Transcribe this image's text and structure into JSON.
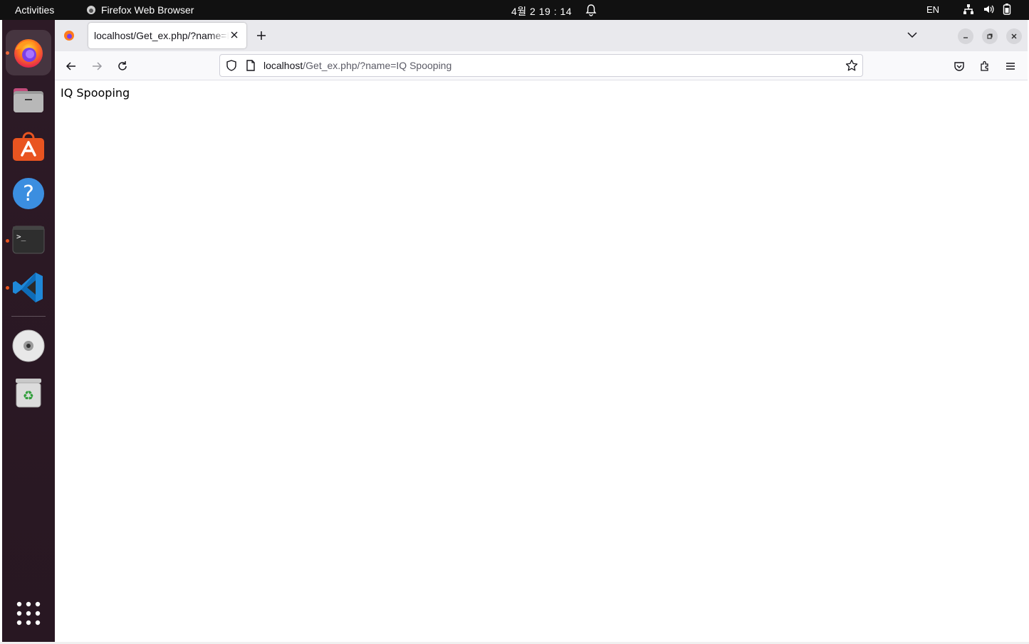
{
  "topbar": {
    "activities": "Activities",
    "app_name": "Firefox Web Browser",
    "clock": "4월 2  19 : 14",
    "language": "EN"
  },
  "dock": {
    "items": [
      "firefox",
      "files",
      "app-center",
      "help",
      "terminal",
      "vscode",
      "disc",
      "trash",
      "show-apps"
    ]
  },
  "browser": {
    "tab": {
      "title": "localhost/Get_ex.php/?name=IQ Spooping"
    },
    "url": {
      "host": "localhost",
      "rest": "/Get_ex.php/?name=IQ Spooping"
    },
    "page_text": "IQ Spooping"
  },
  "colors": {
    "accent": "#e95420",
    "topbar_bg": "#111111",
    "dock_bg": "#2b1b24",
    "tabstrip_bg": "#e9e9ed"
  }
}
